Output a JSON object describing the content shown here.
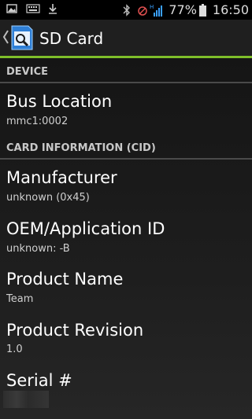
{
  "status_bar": {
    "battery_percent": "77%",
    "time": "16:50",
    "left_icons": [
      "image-icon",
      "keyboard-icon",
      "download-icon"
    ],
    "right_icons": [
      "bluetooth-icon",
      "signal-h-icon"
    ]
  },
  "action_bar": {
    "title": "SD Card",
    "accent_color": "#7fbf2a"
  },
  "sections": {
    "device": {
      "header": "DEVICE"
    },
    "cid": {
      "header": "CARD INFORMATION (CID)"
    }
  },
  "items": {
    "bus_location": {
      "title": "Bus Location",
      "value": "mmc1:0002"
    },
    "manufacturer": {
      "title": "Manufacturer",
      "value": "unknown (0x45)"
    },
    "oem_app_id": {
      "title": "OEM/Application ID",
      "value": "unknown: -B"
    },
    "product_name": {
      "title": "Product Name",
      "value": "Team"
    },
    "product_revision": {
      "title": "Product Revision",
      "value": "1.0"
    },
    "serial": {
      "title": "Serial #",
      "value": ""
    }
  }
}
